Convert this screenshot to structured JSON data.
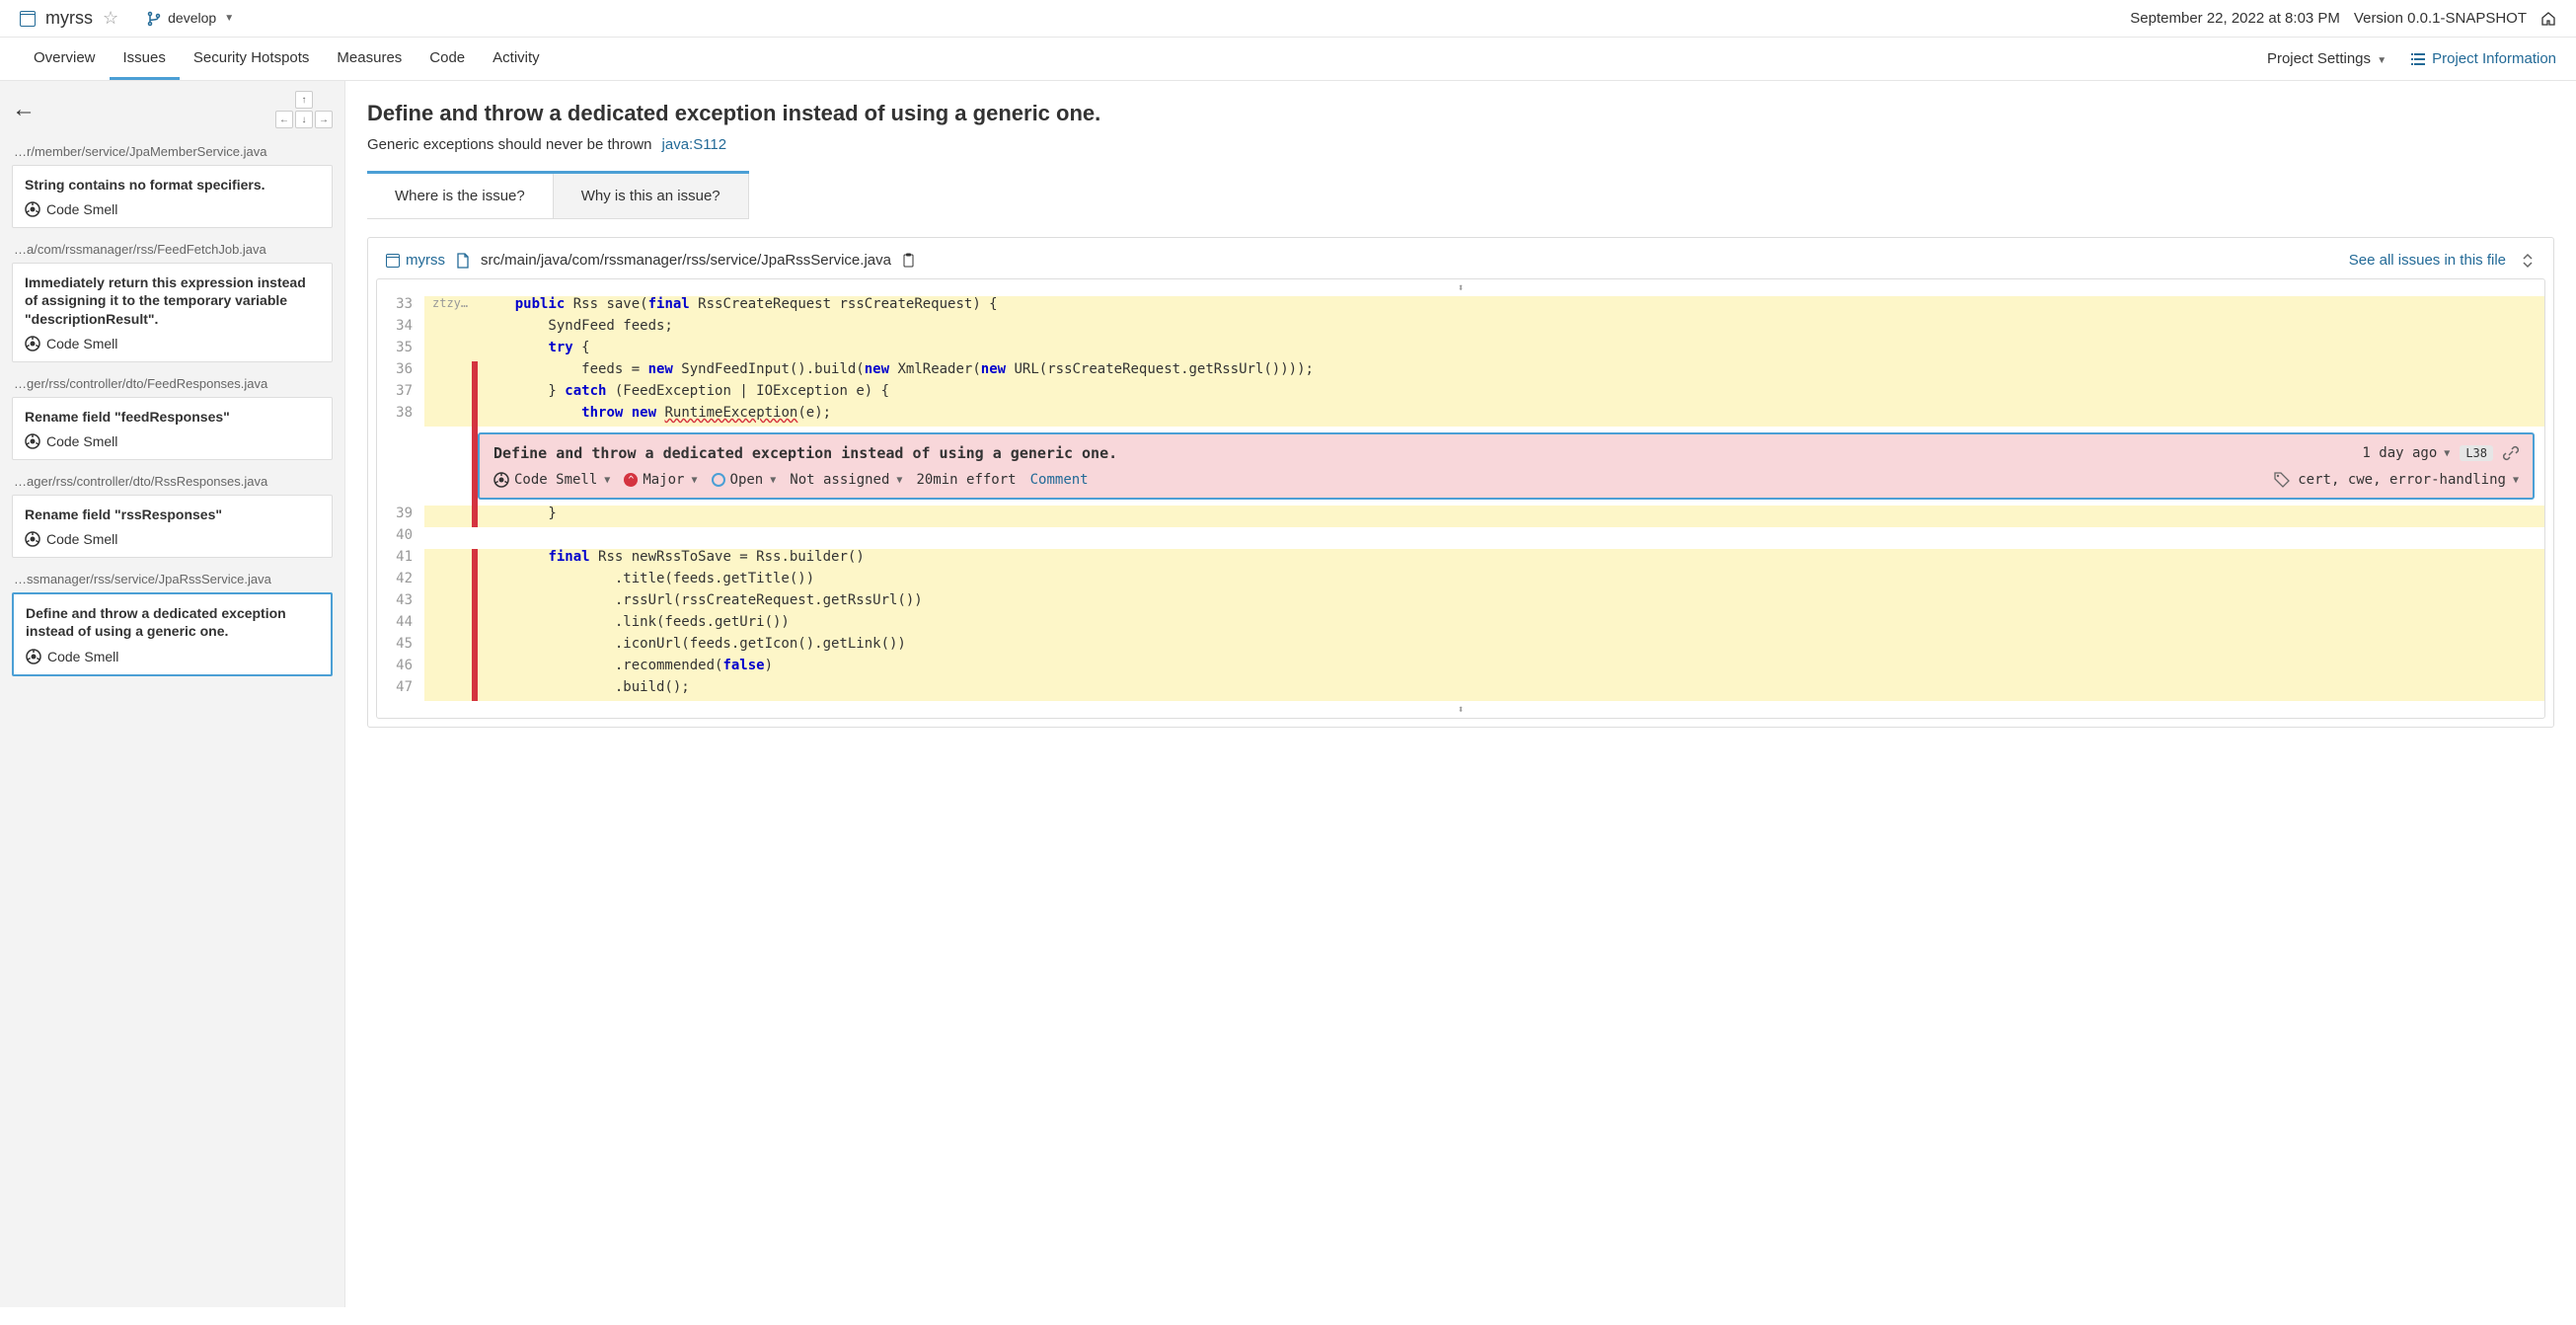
{
  "header": {
    "project": "myrss",
    "branch": "develop",
    "timestamp": "September 22, 2022 at 8:03 PM",
    "version": "Version 0.0.1-SNAPSHOT"
  },
  "nav": {
    "tabs": [
      "Overview",
      "Issues",
      "Security Hotspots",
      "Measures",
      "Code",
      "Activity"
    ],
    "active": "Issues",
    "settings": "Project Settings",
    "info": "Project Information"
  },
  "sidebar": {
    "groups": [
      {
        "path": "…r/member/service/JpaMemberService.java",
        "issues": [
          {
            "title": "String contains no format specifiers.",
            "type": "Code Smell"
          }
        ]
      },
      {
        "path": "…a/com/rssmanager/rss/FeedFetchJob.java",
        "issues": [
          {
            "title": "Immediately return this expression instead of assigning it to the temporary variable \"descriptionResult\".",
            "type": "Code Smell"
          }
        ]
      },
      {
        "path": "…ger/rss/controller/dto/FeedResponses.java",
        "issues": [
          {
            "title": "Rename field \"feedResponses\"",
            "type": "Code Smell"
          }
        ]
      },
      {
        "path": "…ager/rss/controller/dto/RssResponses.java",
        "issues": [
          {
            "title": "Rename field \"rssResponses\"",
            "type": "Code Smell"
          }
        ]
      },
      {
        "path": "…ssmanager/rss/service/JpaRssService.java",
        "issues": [
          {
            "title": "Define and throw a dedicated exception instead of using a generic one.",
            "type": "Code Smell",
            "selected": true
          }
        ]
      }
    ]
  },
  "issue": {
    "title": "Define and throw a dedicated exception instead of using a generic one.",
    "rule_desc": "Generic exceptions should never be thrown",
    "rule_id": "java:S112",
    "tabs": {
      "t1": "Where is the issue?",
      "t2": "Why is this an issue?"
    },
    "breadcrumb": {
      "project": "myrss",
      "path": "src/main/java/com/rssmanager/rss/service/JpaRssService.java",
      "see_all": "See all issues in this file"
    },
    "inline": {
      "title": "Define and throw a dedicated exception instead of using a generic one.",
      "age": "1 day ago",
      "line": "L38",
      "type": "Code Smell",
      "severity": "Major",
      "status": "Open",
      "assignee": "Not assigned",
      "effort": "20min effort",
      "comment": "Comment",
      "tags": "cert, cwe, error-handling"
    },
    "code": {
      "l33_marker": "ztzy…",
      "l33": "public Rss save(final RssCreateRequest rssCreateRequest) {",
      "l34": "    SyndFeed feeds;",
      "l35": "    try {",
      "l36": "        feeds = new SyndFeedInput().build(new XmlReader(new URL(rssCreateRequest.getRssUrl())));",
      "l37": "    } catch (FeedException | IOException e) {",
      "l38": "        throw new RuntimeException(e);",
      "l39": "    }",
      "l40": "",
      "l41": "    final Rss newRssToSave = Rss.builder()",
      "l42": "            .title(feeds.getTitle())",
      "l43": "            .rssUrl(rssCreateRequest.getRssUrl())",
      "l44": "            .link(feeds.getUri())",
      "l45": "            .iconUrl(feeds.getIcon().getLink())",
      "l46": "            .recommended(false)",
      "l47": "            .build();"
    }
  }
}
